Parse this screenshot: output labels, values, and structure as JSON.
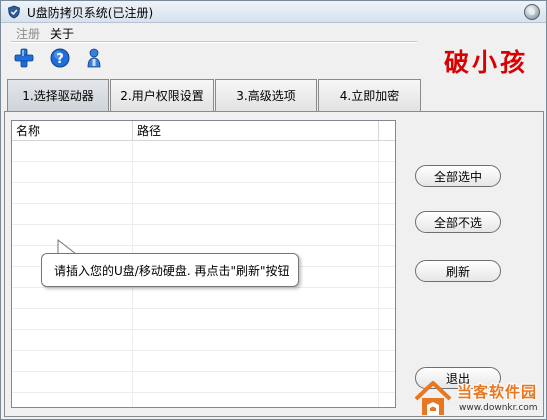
{
  "window": {
    "title": "U盘防拷贝系统(已注册)"
  },
  "menu": {
    "register": "注册",
    "about": "关于"
  },
  "toolbar": [
    "add-icon",
    "help-icon",
    "user-icon"
  ],
  "crack_label": "破小孩",
  "tabs": [
    {
      "label": "1.选择驱动器",
      "active": true
    },
    {
      "label": "2.用户权限设置",
      "active": false
    },
    {
      "label": "3.高级选项",
      "active": false
    },
    {
      "label": "4.立即加密",
      "active": false
    }
  ],
  "list": {
    "columns": [
      "名称",
      "路径"
    ],
    "rows": []
  },
  "buttons": {
    "select_all": "全部选中",
    "deselect_all": "全部不选",
    "refresh": "刷新",
    "exit": "退出"
  },
  "tooltip": "请插入您的U盘/移动硬盘. 再点击\"刷新\"按钮",
  "watermark": {
    "title": "当客软件园",
    "url": "www.downkr.com"
  },
  "colors": {
    "crack_label": "#d80000",
    "watermark": "#e87722",
    "toolbar_add": "#1e6fd9",
    "toolbar_help": "#1e6fd9"
  }
}
